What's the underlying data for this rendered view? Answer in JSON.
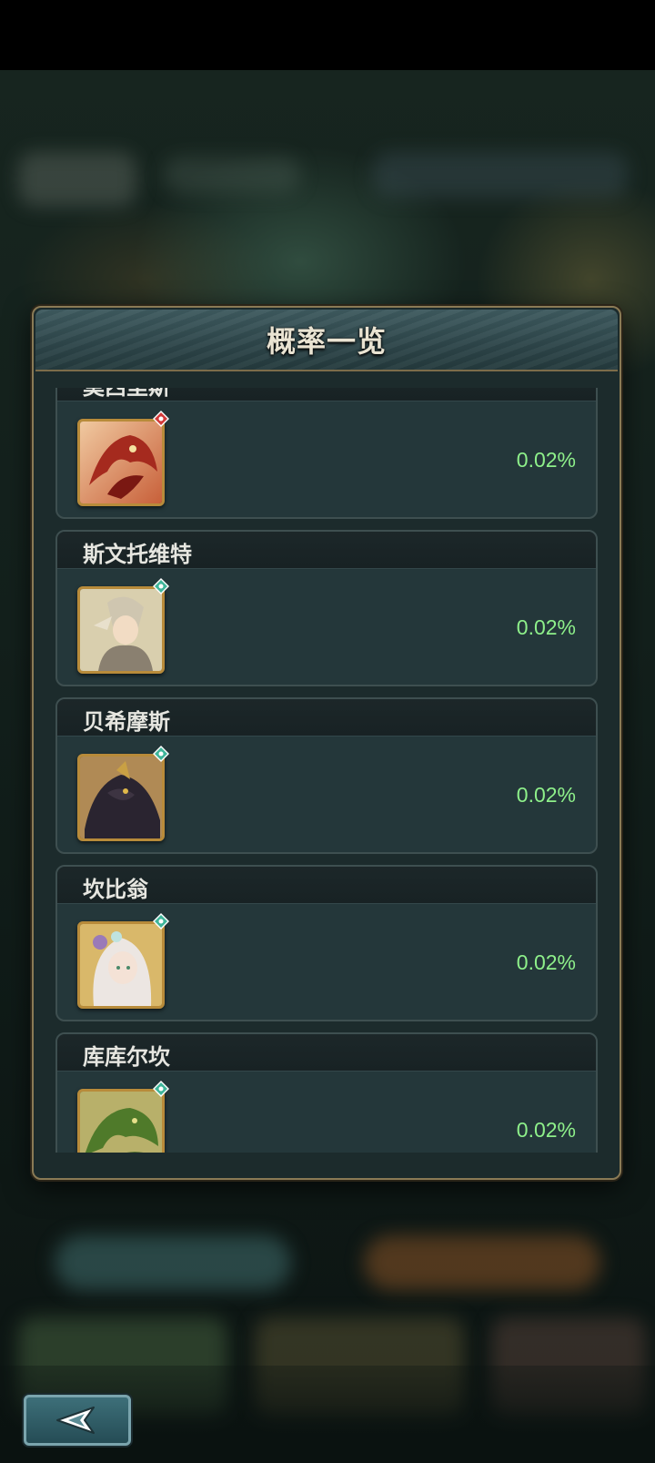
{
  "dialog": {
    "title": "概率一览"
  },
  "items": [
    {
      "name": "莫西里斯",
      "rate": "0.02%",
      "element": "fire",
      "element_color": "#d23a3a",
      "portrait_icon": "red-dragon-portrait-icon"
    },
    {
      "name": "斯文托维特",
      "rate": "0.02%",
      "element": "wind",
      "element_color": "#3fb59a",
      "portrait_icon": "armored-knight-portrait-icon"
    },
    {
      "name": "贝希摩斯",
      "rate": "0.02%",
      "element": "wind",
      "element_color": "#3fb59a",
      "portrait_icon": "dark-beast-portrait-icon"
    },
    {
      "name": "坎比翁",
      "rate": "0.02%",
      "element": "wind",
      "element_color": "#3fb59a",
      "portrait_icon": "elf-girl-portrait-icon"
    },
    {
      "name": "库库尔坎",
      "rate": "0.02%",
      "element": "wind",
      "element_color": "#3fb59a",
      "portrait_icon": "green-dragon-portrait-icon"
    }
  ],
  "colors": {
    "rate_text": "#8ef08a",
    "frame_gold": "#b88b3a",
    "panel": "#24373a"
  },
  "back_button": {
    "icon": "back-arrow-icon"
  }
}
